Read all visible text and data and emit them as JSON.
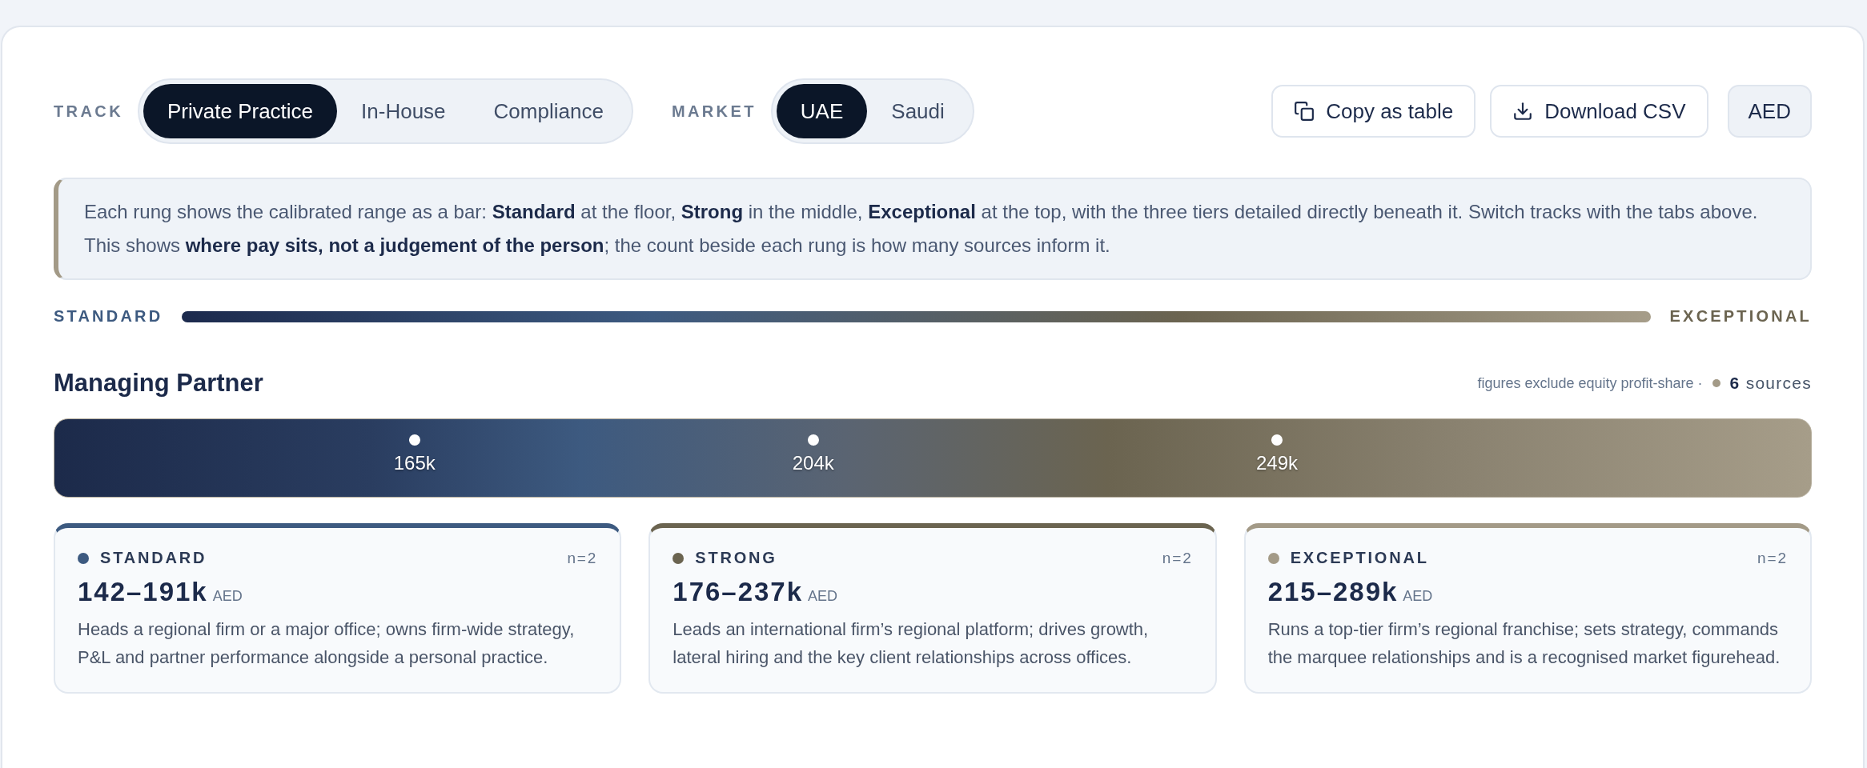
{
  "filters": [
    {
      "label": "TRACK",
      "options": [
        {
          "label": "Private Practice",
          "selected": true
        },
        {
          "label": "In-House",
          "selected": false
        },
        {
          "label": "Compliance",
          "selected": false
        }
      ]
    },
    {
      "label": "MARKET",
      "options": [
        {
          "label": "UAE",
          "selected": true
        },
        {
          "label": "Saudi",
          "selected": false
        }
      ]
    }
  ],
  "actions": [
    {
      "kind": "copy",
      "label": "Copy as table"
    },
    {
      "kind": "download",
      "label": "Download CSV"
    }
  ],
  "currency": {
    "label": "AED"
  },
  "note": "Each rung shows the calibrated range as a bar: **Standard** at the floor, **Strong** in the middle, **Exceptional** at the top, with the three tiers detailed directly beneath it. Switch tracks with the tabs above. This shows **where pay sits, not a judgement of the person**; the count beside each rung is how many sources inform it.",
  "scale": {
    "low": "STANDARD",
    "high": "EXCEPTIONAL"
  },
  "rung": {
    "title": "Managing Partner",
    "footnote": "figures exclude equity profit-share ·",
    "sources": "**6** sources",
    "markers": [
      {
        "label": "165k",
        "level": 0.205
      },
      {
        "label": "204k",
        "level": 0.432
      },
      {
        "label": "249k",
        "level": 0.696
      }
    ],
    "tiers": [
      {
        "name": "STANDARD",
        "color": "#3d5a80",
        "count": "n=2",
        "range": "142–191k",
        "currency": "AED",
        "description": "Heads a regional firm or a major office; owns firm-wide strategy, P&L and partner performance alongside a personal practice."
      },
      {
        "name": "STRONG",
        "color": "#6b6450",
        "count": "n=2",
        "range": "176–237k",
        "currency": "AED",
        "description": "Leads an international firm’s regional platform; drives growth, lateral hiring and the key client relationships across offices."
      },
      {
        "name": "EXCEPTIONAL",
        "color": "#a39a87",
        "count": "n=2",
        "range": "215–289k",
        "currency": "AED",
        "description": "Runs a top-tier firm’s regional franchise; sets strategy, commands the marquee relationships and is a recognised market figurehead."
      }
    ]
  }
}
